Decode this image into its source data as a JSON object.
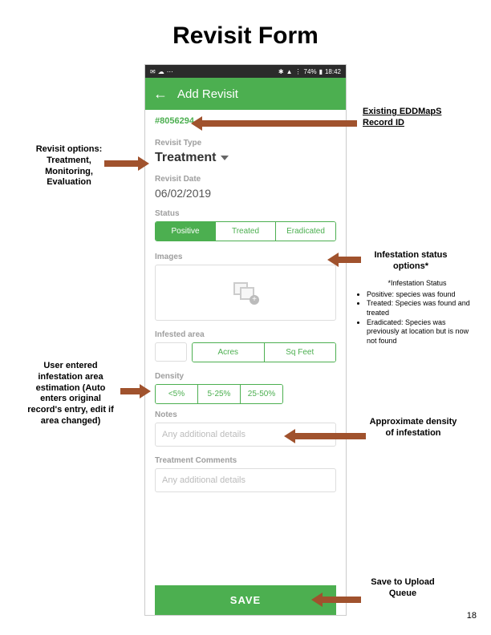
{
  "page": {
    "title": "Revisit Form",
    "page_number": "18"
  },
  "status_bar": {
    "battery": "74%",
    "time": "18:42"
  },
  "app_bar": {
    "title": "Add Revisit"
  },
  "record": {
    "id": "#8056294"
  },
  "revisit_type": {
    "label": "Revisit Type",
    "value": "Treatment"
  },
  "revisit_date": {
    "label": "Revisit Date",
    "value": "06/02/2019"
  },
  "status": {
    "label": "Status",
    "options": [
      "Positive",
      "Treated",
      "Eradicated"
    ]
  },
  "images": {
    "label": "Images"
  },
  "infested_area": {
    "label": "Infested area",
    "units": [
      "Acres",
      "Sq Feet"
    ]
  },
  "density": {
    "label": "Density",
    "options": [
      "<5%",
      "5-25%",
      "25-50%"
    ]
  },
  "notes": {
    "label": "Notes",
    "placeholder": "Any additional details"
  },
  "treatment_comments": {
    "label": "Treatment Comments",
    "placeholder": "Any additional details"
  },
  "save": {
    "label": "SAVE"
  },
  "callouts": {
    "record_id": "Existing EDDMapS Record ID",
    "revisit_options": "Revisit options: Treatment, Monitoring, Evaluation",
    "status_options": "Infestation status options*",
    "area_entry": "User entered infestation area estimation (Auto enters original record's entry, edit if area changed)",
    "density": "Approximate density of infestation",
    "save": "Save to Upload Queue"
  },
  "footnote": {
    "title": "*Infestation Status",
    "items": [
      "Positive: species was found",
      "Treated: Species was found and treated",
      "Eradicated: Species was previously at location but is now not found"
    ]
  }
}
